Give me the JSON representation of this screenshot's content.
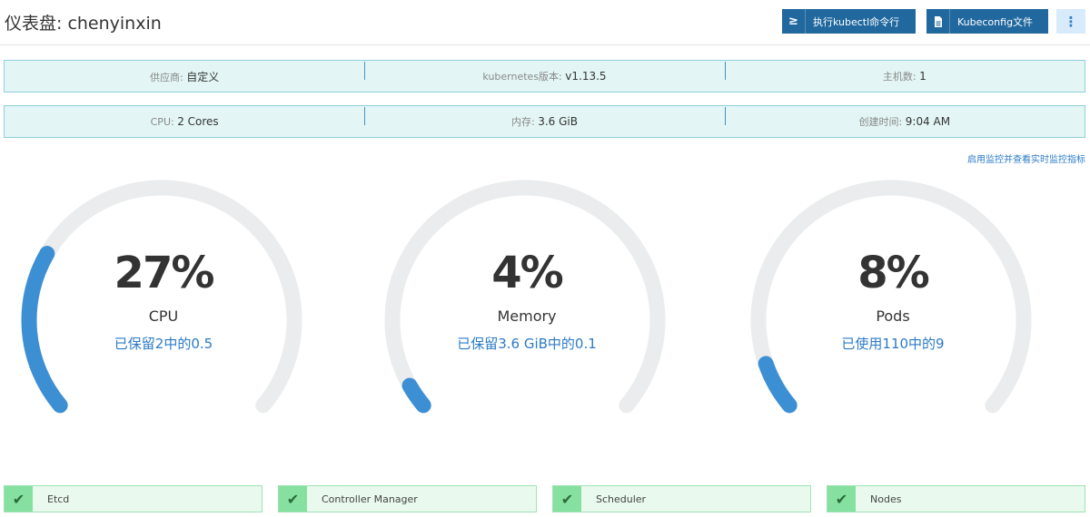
{
  "header": {
    "title": "仪表盘: chenyinxin",
    "kubectl_button": {
      "icon": "≥",
      "label": "执行kubectl命令行"
    },
    "kubeconfig_button": {
      "icon": "file-icon",
      "label": "Kubeconfig文件"
    },
    "more_button": {
      "icon": "⋮"
    }
  },
  "info_rows": [
    [
      {
        "key": "供应商:",
        "value": "自定义"
      },
      {
        "key": "kubernetes版本:",
        "value": "v1.13.5"
      },
      {
        "key": "主机数:",
        "value": "1"
      }
    ],
    [
      {
        "key": "CPU:",
        "value": "2 Cores"
      },
      {
        "key": "内存:",
        "value": "3.6 GiB"
      },
      {
        "key": "创建时间:",
        "value": "9:04 AM"
      }
    ]
  ],
  "monitor_link": "启用监控并查看实时监控指标",
  "gauges": [
    {
      "percent": "27%",
      "label": "CPU",
      "detail": "已保留2中的0.5",
      "value": 0.27
    },
    {
      "percent": "4%",
      "label": "Memory",
      "detail": "已保留3.6 GiB中的0.1",
      "value": 0.04
    },
    {
      "percent": "8%",
      "label": "Pods",
      "detail": "已使用110中的9",
      "value": 0.08
    }
  ],
  "components": [
    {
      "label": "Etcd",
      "status": "healthy"
    },
    {
      "label": "Controller Manager",
      "status": "healthy"
    },
    {
      "label": "Scheduler",
      "status": "healthy"
    },
    {
      "label": "Nodes",
      "status": "healthy"
    }
  ],
  "colors": {
    "primary": "#21689f",
    "gauge_fill": "#3d8fd4",
    "gauge_track": "#eaeced",
    "healthy": "#86e0a0",
    "info_bg": "#e3f6f5"
  }
}
